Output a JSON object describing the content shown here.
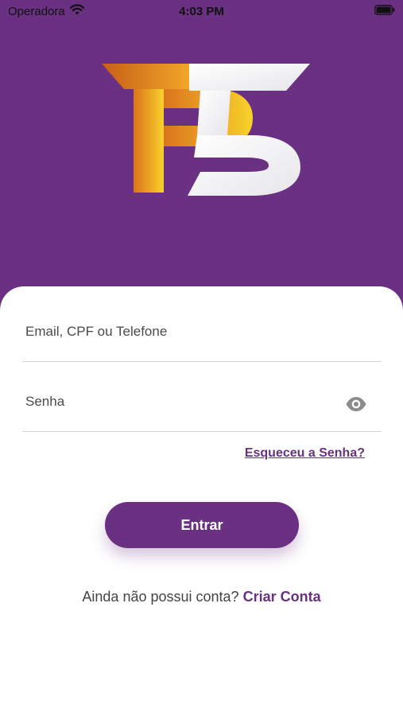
{
  "status_bar": {
    "carrier": "Operadora",
    "time": "4:03 PM"
  },
  "logo": {
    "text": "P5"
  },
  "login": {
    "email_placeholder": "Email, CPF ou Telefone",
    "password_placeholder": "Senha",
    "forgot_password_label": "Esqueceu a Senha?",
    "enter_label": "Entrar",
    "signup_prompt": "Ainda não possui conta?",
    "signup_link": "Criar Conta"
  },
  "colors": {
    "brand": "#6a3081",
    "text": "#444444",
    "field_border": "#d6d6d6",
    "logo_gold": "#f0b22a",
    "logo_orange": "#d9751f"
  },
  "icons": {
    "wifi": "wifi-icon",
    "battery": "battery-icon",
    "password_visibility": "eye-icon"
  }
}
